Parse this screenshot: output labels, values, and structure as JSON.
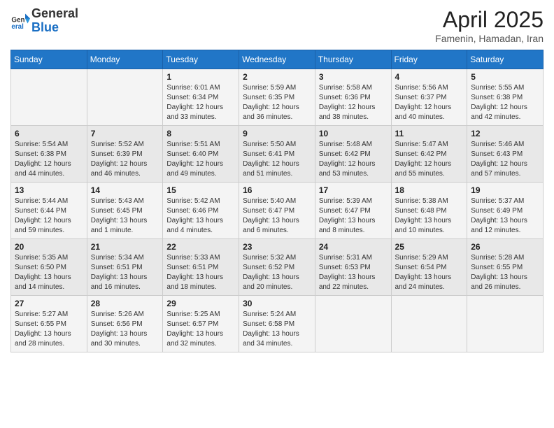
{
  "header": {
    "logo_general": "General",
    "logo_blue": "Blue",
    "title": "April 2025",
    "subtitle": "Famenin, Hamadan, Iran"
  },
  "weekdays": [
    "Sunday",
    "Monday",
    "Tuesday",
    "Wednesday",
    "Thursday",
    "Friday",
    "Saturday"
  ],
  "weeks": [
    [
      {
        "day": "",
        "info": ""
      },
      {
        "day": "",
        "info": ""
      },
      {
        "day": "1",
        "info": "Sunrise: 6:01 AM\nSunset: 6:34 PM\nDaylight: 12 hours and 33 minutes."
      },
      {
        "day": "2",
        "info": "Sunrise: 5:59 AM\nSunset: 6:35 PM\nDaylight: 12 hours and 36 minutes."
      },
      {
        "day": "3",
        "info": "Sunrise: 5:58 AM\nSunset: 6:36 PM\nDaylight: 12 hours and 38 minutes."
      },
      {
        "day": "4",
        "info": "Sunrise: 5:56 AM\nSunset: 6:37 PM\nDaylight: 12 hours and 40 minutes."
      },
      {
        "day": "5",
        "info": "Sunrise: 5:55 AM\nSunset: 6:38 PM\nDaylight: 12 hours and 42 minutes."
      }
    ],
    [
      {
        "day": "6",
        "info": "Sunrise: 5:54 AM\nSunset: 6:38 PM\nDaylight: 12 hours and 44 minutes."
      },
      {
        "day": "7",
        "info": "Sunrise: 5:52 AM\nSunset: 6:39 PM\nDaylight: 12 hours and 46 minutes."
      },
      {
        "day": "8",
        "info": "Sunrise: 5:51 AM\nSunset: 6:40 PM\nDaylight: 12 hours and 49 minutes."
      },
      {
        "day": "9",
        "info": "Sunrise: 5:50 AM\nSunset: 6:41 PM\nDaylight: 12 hours and 51 minutes."
      },
      {
        "day": "10",
        "info": "Sunrise: 5:48 AM\nSunset: 6:42 PM\nDaylight: 12 hours and 53 minutes."
      },
      {
        "day": "11",
        "info": "Sunrise: 5:47 AM\nSunset: 6:42 PM\nDaylight: 12 hours and 55 minutes."
      },
      {
        "day": "12",
        "info": "Sunrise: 5:46 AM\nSunset: 6:43 PM\nDaylight: 12 hours and 57 minutes."
      }
    ],
    [
      {
        "day": "13",
        "info": "Sunrise: 5:44 AM\nSunset: 6:44 PM\nDaylight: 12 hours and 59 minutes."
      },
      {
        "day": "14",
        "info": "Sunrise: 5:43 AM\nSunset: 6:45 PM\nDaylight: 13 hours and 1 minute."
      },
      {
        "day": "15",
        "info": "Sunrise: 5:42 AM\nSunset: 6:46 PM\nDaylight: 13 hours and 4 minutes."
      },
      {
        "day": "16",
        "info": "Sunrise: 5:40 AM\nSunset: 6:47 PM\nDaylight: 13 hours and 6 minutes."
      },
      {
        "day": "17",
        "info": "Sunrise: 5:39 AM\nSunset: 6:47 PM\nDaylight: 13 hours and 8 minutes."
      },
      {
        "day": "18",
        "info": "Sunrise: 5:38 AM\nSunset: 6:48 PM\nDaylight: 13 hours and 10 minutes."
      },
      {
        "day": "19",
        "info": "Sunrise: 5:37 AM\nSunset: 6:49 PM\nDaylight: 13 hours and 12 minutes."
      }
    ],
    [
      {
        "day": "20",
        "info": "Sunrise: 5:35 AM\nSunset: 6:50 PM\nDaylight: 13 hours and 14 minutes."
      },
      {
        "day": "21",
        "info": "Sunrise: 5:34 AM\nSunset: 6:51 PM\nDaylight: 13 hours and 16 minutes."
      },
      {
        "day": "22",
        "info": "Sunrise: 5:33 AM\nSunset: 6:51 PM\nDaylight: 13 hours and 18 minutes."
      },
      {
        "day": "23",
        "info": "Sunrise: 5:32 AM\nSunset: 6:52 PM\nDaylight: 13 hours and 20 minutes."
      },
      {
        "day": "24",
        "info": "Sunrise: 5:31 AM\nSunset: 6:53 PM\nDaylight: 13 hours and 22 minutes."
      },
      {
        "day": "25",
        "info": "Sunrise: 5:29 AM\nSunset: 6:54 PM\nDaylight: 13 hours and 24 minutes."
      },
      {
        "day": "26",
        "info": "Sunrise: 5:28 AM\nSunset: 6:55 PM\nDaylight: 13 hours and 26 minutes."
      }
    ],
    [
      {
        "day": "27",
        "info": "Sunrise: 5:27 AM\nSunset: 6:55 PM\nDaylight: 13 hours and 28 minutes."
      },
      {
        "day": "28",
        "info": "Sunrise: 5:26 AM\nSunset: 6:56 PM\nDaylight: 13 hours and 30 minutes."
      },
      {
        "day": "29",
        "info": "Sunrise: 5:25 AM\nSunset: 6:57 PM\nDaylight: 13 hours and 32 minutes."
      },
      {
        "day": "30",
        "info": "Sunrise: 5:24 AM\nSunset: 6:58 PM\nDaylight: 13 hours and 34 minutes."
      },
      {
        "day": "",
        "info": ""
      },
      {
        "day": "",
        "info": ""
      },
      {
        "day": "",
        "info": ""
      }
    ]
  ]
}
